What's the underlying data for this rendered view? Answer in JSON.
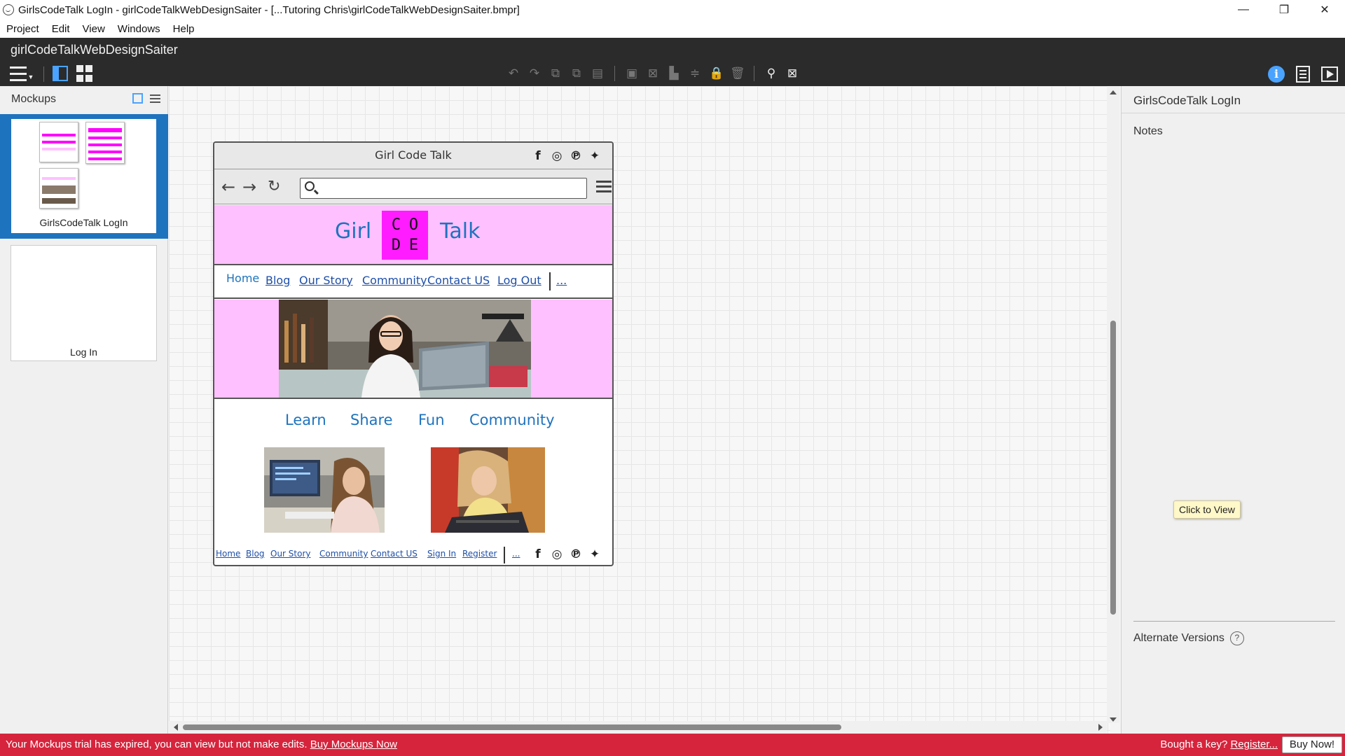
{
  "window": {
    "title": "GirlsCodeTalk LogIn - girlCodeTalkWebDesignSaiter - [...Tutoring Chris\\girlCodeTalkWebDesignSaiter.bmpr]",
    "minimize": "—",
    "maximize": "❐",
    "close": "✕"
  },
  "menu": [
    "Project",
    "Edit",
    "View",
    "Windows",
    "Help"
  ],
  "toolbar": {
    "project_name": "girlCodeTalkWebDesignSaiter"
  },
  "mockups_panel": {
    "title": "Mockups",
    "items": [
      {
        "label": "GirlsCodeTalk LogIn",
        "selected": true
      },
      {
        "label": "Log In",
        "selected": false
      }
    ]
  },
  "browser_mockup": {
    "title": "Girl Code Talk",
    "social_icons": [
      "facebook-icon",
      "instagram-icon",
      "pinterest-icon",
      "twitter-icon"
    ],
    "logo": {
      "left": "Girl",
      "right": "Talk",
      "code_letters": [
        "C",
        "O",
        "D",
        "E"
      ]
    },
    "nav_links": [
      "Home",
      "Blog",
      "Our Story",
      "Community",
      "Contact US",
      "Log Out",
      "..."
    ],
    "feature_links": [
      "Learn",
      "Share",
      "Fun",
      "Community"
    ],
    "footer_links": [
      "Home",
      "Blog",
      "Our Story",
      "Community",
      "Contact US",
      "Sign In",
      "Register",
      "..."
    ]
  },
  "right_panel": {
    "title": "GirlsCodeTalk LogIn",
    "notes_label": "Notes",
    "tooltip": "Click to View",
    "alt_versions": "Alternate Versions",
    "help": "?"
  },
  "bottom_bar": {
    "message": "Your Mockups trial has expired, you can view but not make edits.",
    "buy_link": "Buy Mockups Now",
    "key_question": "Bought a key?",
    "register_link": "Register...",
    "buy_button": "Buy Now!"
  },
  "colors": {
    "accent_blue": "#1e73be",
    "pink_band": "#ffc0ff",
    "magenta": "#ff1dff",
    "trial_red": "#d6243c",
    "toolbar_dark": "#2b2b2b"
  }
}
